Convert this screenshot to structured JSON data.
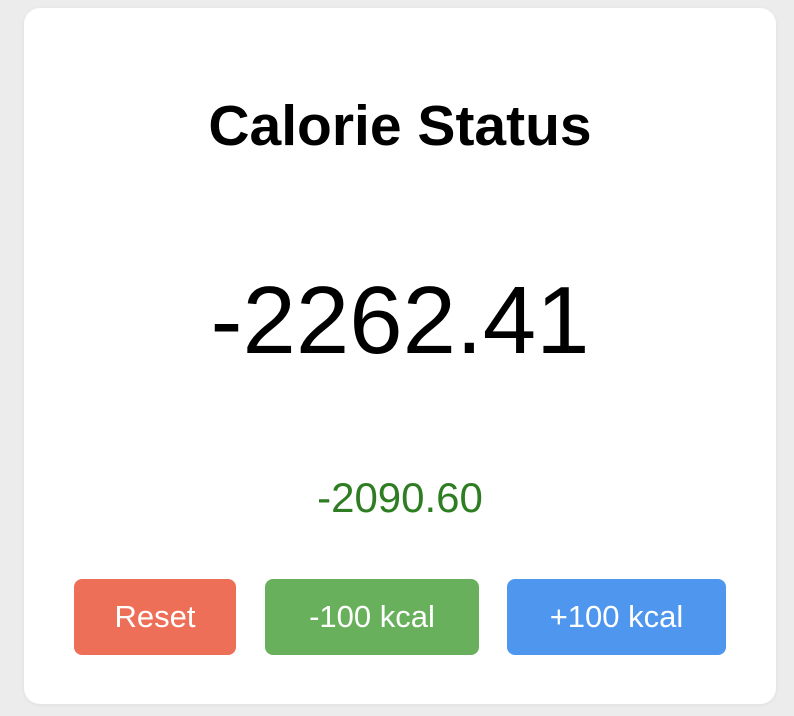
{
  "card": {
    "title": "Calorie Status",
    "main_value": "-2262.41",
    "sub_value": "-2090.60"
  },
  "buttons": {
    "reset_label": "Reset",
    "minus_label": "-100 kcal",
    "plus_label": "+100 kcal"
  },
  "colors": {
    "sub_value": "#2e7d22",
    "reset": "#ee6f57",
    "minus": "#69b05d",
    "plus": "#4e96ee"
  }
}
